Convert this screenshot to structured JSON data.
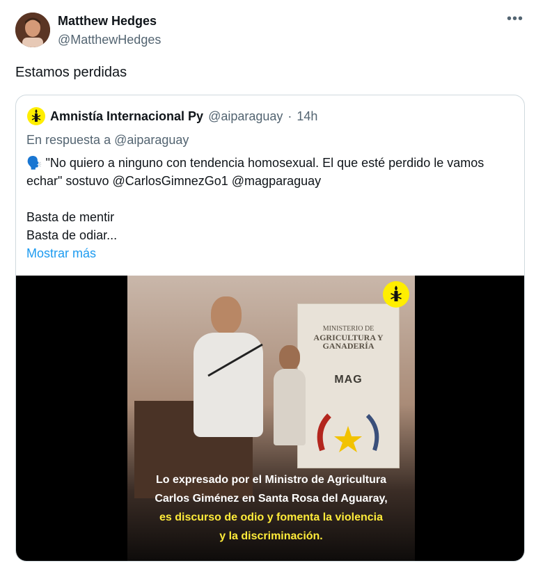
{
  "author": {
    "name": "Matthew Hedges",
    "handle": "@MatthewHedges",
    "avatar_icon": "profile-photo",
    "more_label": "•••"
  },
  "tweet": {
    "text": "Estamos perdidas"
  },
  "quoted": {
    "logo_icon": "candle-in-barbed-wire-icon",
    "name": "Amnistía Internacional Py",
    "handle": "@aiparaguay",
    "separator": "·",
    "time": "14h",
    "reply_to": "En respuesta a @aiparaguay",
    "speaker_emoji": "🗣️",
    "line1": "\"No quiero a ninguno con tendencia homosexual. El que esté perdido le vamos echar\" sostuvo @CarlosGimnezGo1 @magparaguay",
    "line2": "Basta de mentir",
    "line3": "Basta de odiar...",
    "show_more": "Mostrar más"
  },
  "video": {
    "banner_text_1": "MINISTERIO DE",
    "banner_text_2": "AGRICULTURA Y",
    "banner_text_3": "GANADERÍA",
    "banner_label": "MAG",
    "caption_white_1": "Lo expresado por el Ministro de Agricultura",
    "caption_white_2": "Carlos Giménez en Santa Rosa del Aguaray,",
    "caption_yellow_1": "es discurso de odio y fomenta la violencia",
    "caption_yellow_2": "y la discriminación.",
    "badge_icon": "amnesty-candle-icon"
  },
  "colors": {
    "link": "#1d9bf0",
    "secondary_text": "#536471",
    "amnesty_yellow": "#ffee00",
    "caption_yellow": "#ffec3a"
  }
}
